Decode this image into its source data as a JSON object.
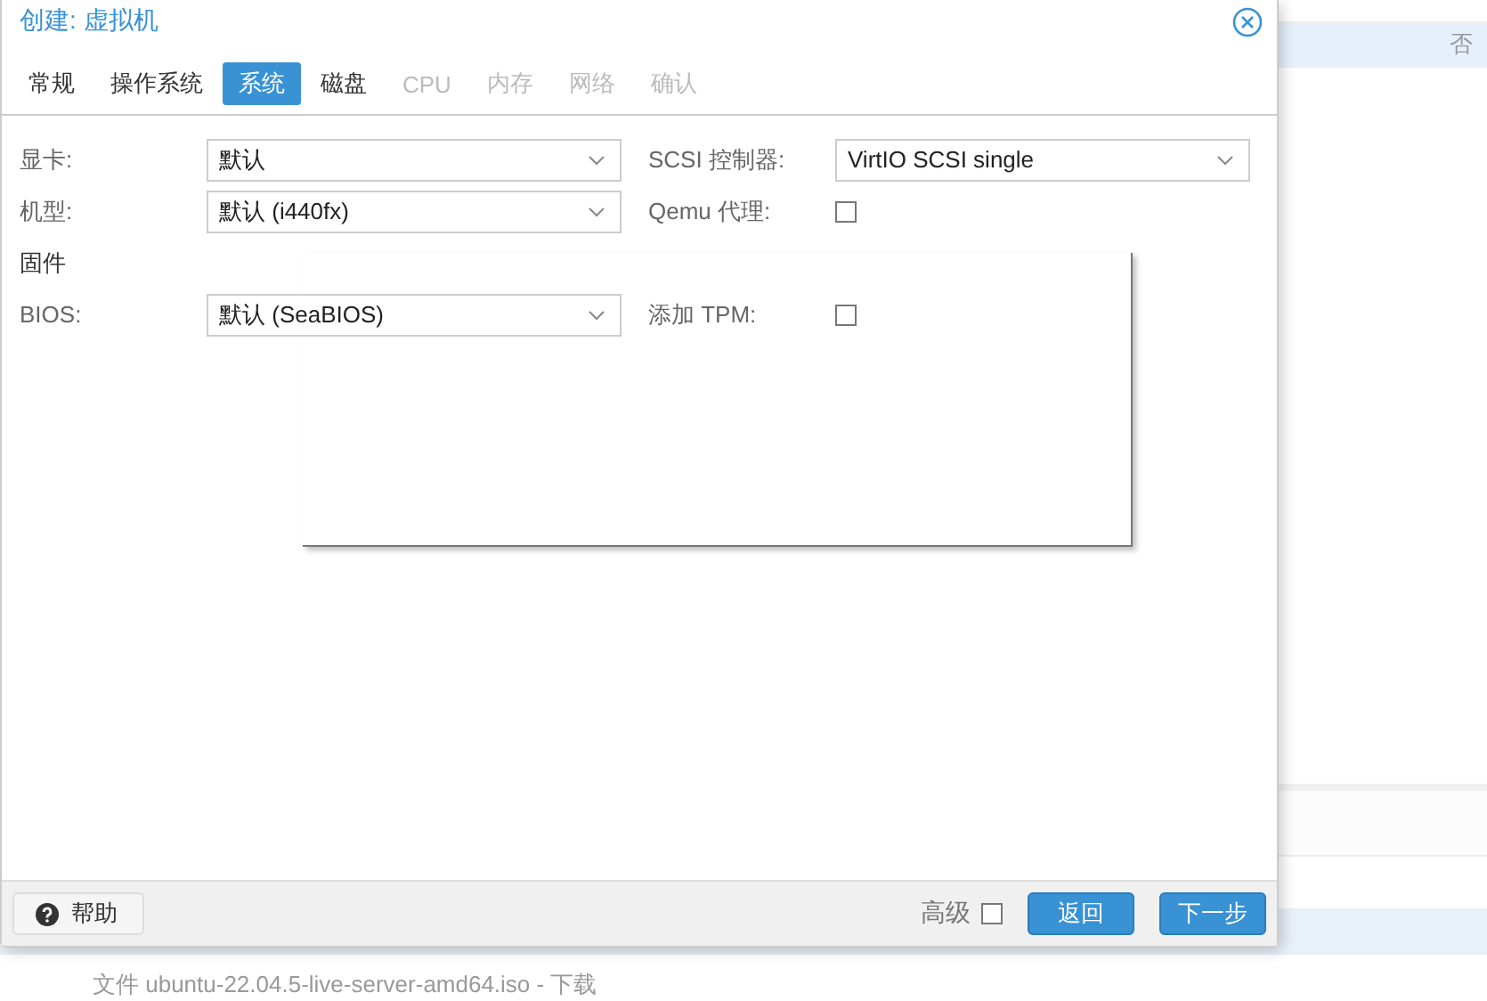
{
  "background": {
    "cell": "否",
    "caption": "文件 ubuntu-22.04.5-live-server-amd64.iso - 下载"
  },
  "window": {
    "title": "创建: 虚拟机"
  },
  "tabs": [
    {
      "label": "常规",
      "selected": false,
      "disabled": false
    },
    {
      "label": "操作系统",
      "selected": false,
      "disabled": false
    },
    {
      "label": "系统",
      "selected": true,
      "disabled": false
    },
    {
      "label": "磁盘",
      "selected": false,
      "disabled": false
    },
    {
      "label": "CPU",
      "selected": false,
      "disabled": true
    },
    {
      "label": "内存",
      "selected": false,
      "disabled": true
    },
    {
      "label": "网络",
      "selected": false,
      "disabled": true
    },
    {
      "label": "确认",
      "selected": false,
      "disabled": true
    }
  ],
  "form": [
    {
      "kind": "pair",
      "fields": [
        {
          "kind": "select",
          "label": "显卡:",
          "value": "默认"
        },
        {
          "kind": "select",
          "label": "SCSI 控制器:",
          "value": "VirtIO SCSI single"
        }
      ]
    },
    {
      "kind": "pair",
      "fields": [
        {
          "kind": "select",
          "label": "机型:",
          "value": "默认 (i440fx)"
        },
        {
          "kind": "checkbox",
          "label": "Qemu 代理:",
          "checked": false
        }
      ]
    },
    {
      "kind": "heading",
      "label": "固件"
    },
    {
      "kind": "pair",
      "fields": [
        {
          "kind": "select",
          "label": "BIOS:",
          "value": "默认 (SeaBIOS)"
        },
        {
          "kind": "checkbox",
          "label": "添加 TPM:",
          "checked": false
        }
      ]
    }
  ],
  "footer": {
    "help": "帮助",
    "advanced": {
      "label": "高级",
      "checked": false
    },
    "buttons": [
      "返回",
      "下一步"
    ]
  }
}
